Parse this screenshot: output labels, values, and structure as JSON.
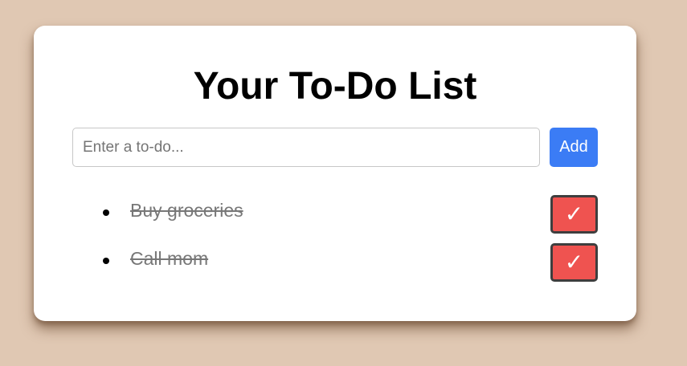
{
  "title": "Your To-Do List",
  "input": {
    "placeholder": "Enter a to-do...",
    "value": ""
  },
  "add_button_label": "Add",
  "todos": [
    {
      "text": "Buy groceries",
      "completed": true,
      "check_symbol": "✓"
    },
    {
      "text": "Call mom",
      "completed": true,
      "check_symbol": "✓"
    }
  ],
  "colors": {
    "background": "#e0c8b3",
    "card": "#ffffff",
    "add_button": "#3b7cf5",
    "check_button": "#ef5350",
    "completed_text": "#777777"
  }
}
